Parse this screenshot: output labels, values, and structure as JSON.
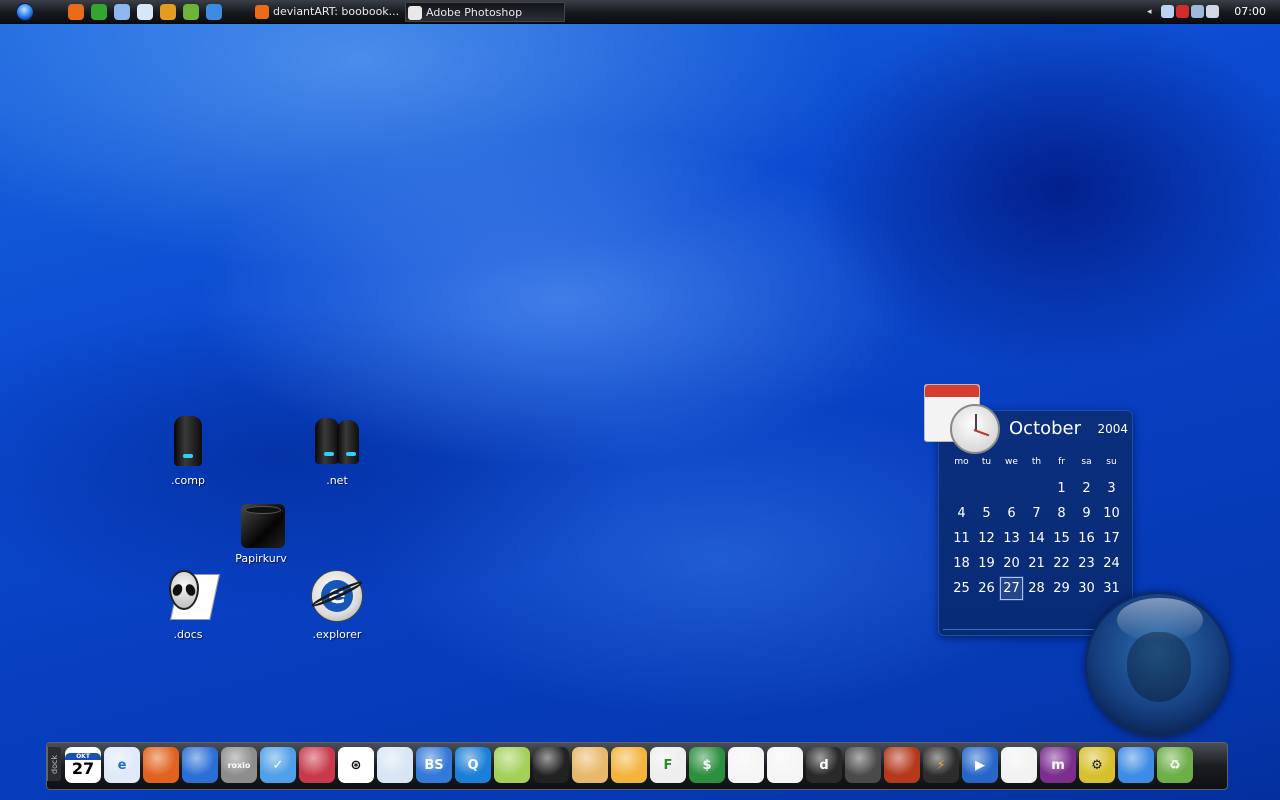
{
  "taskbar": {
    "start_icon": "windows-orb-icon",
    "quick_launch": [
      {
        "icon": "firefox-icon",
        "color": "#e86b1a"
      },
      {
        "icon": "internet-explorer-icon",
        "color": "#35a531"
      },
      {
        "icon": "show-desktop-icon",
        "color": "#8db8ef"
      },
      {
        "icon": "media-player-icon",
        "color": "#d8e6f5"
      },
      {
        "icon": "winamp-icon",
        "color": "#e39c1e"
      },
      {
        "icon": "utility-icon",
        "color": "#6fb43a"
      },
      {
        "icon": "search-icon",
        "color": "#3c8ce0"
      }
    ],
    "tasks": [
      {
        "label": "deviantART: boobook...",
        "icon": "firefox-icon",
        "active": false
      },
      {
        "label": "Adobe Photoshop",
        "icon": "photoshop-icon",
        "active": true
      }
    ],
    "tray": {
      "show_hidden": "◂",
      "icons": [
        "network-icon",
        "antivirus-icon",
        "volume-icon",
        "messenger-icon"
      ]
    },
    "clock": "07:00"
  },
  "desktop_icons": [
    {
      "label": ".comp",
      "icon": "computer-tower-icon"
    },
    {
      "label": ".net",
      "icon": "network-towers-icon"
    },
    {
      "label": "Papirkurv",
      "icon": "recycle-bin-icon"
    },
    {
      "label": ".docs",
      "icon": "alien-documents-icon"
    },
    {
      "label": ".explorer",
      "icon": "internet-explorer-icon"
    }
  ],
  "calendar": {
    "month": "October",
    "year": "2004",
    "weekdays": [
      "mo",
      "tu",
      "we",
      "th",
      "fr",
      "sa",
      "su"
    ],
    "weeks": [
      [
        "",
        "",
        "",
        "",
        "1",
        "2",
        "3"
      ],
      [
        "4",
        "5",
        "6",
        "7",
        "8",
        "9",
        "10"
      ],
      [
        "11",
        "12",
        "13",
        "14",
        "15",
        "16",
        "17"
      ],
      [
        "18",
        "19",
        "20",
        "21",
        "22",
        "23",
        "24"
      ],
      [
        "25",
        "26",
        "27",
        "28",
        "29",
        "30",
        "31"
      ]
    ],
    "today": "27"
  },
  "dock": {
    "tab_label": "dock",
    "calendar_icon": {
      "month": "OKT",
      "day": "27"
    },
    "items": [
      {
        "icon": "internet-explorer-icon",
        "bg": "#dfe9f7",
        "glyph": "e",
        "color": "#1f6fd0"
      },
      {
        "icon": "firefox-icon",
        "bg": "#e0621e",
        "glyph": "",
        "color": "#fff"
      },
      {
        "icon": "thunderbird-icon",
        "bg": "#2b6fd6",
        "glyph": "",
        "color": "#fff"
      },
      {
        "icon": "roxio-icon",
        "bg": "#8d8d8d",
        "glyph": "roxio",
        "color": "#fff"
      },
      {
        "icon": "messenger-icon",
        "bg": "#4fa0e8",
        "glyph": "✓",
        "color": "#fff"
      },
      {
        "icon": "maya-icon",
        "bg": "#c9394b",
        "glyph": "",
        "color": "#fff"
      },
      {
        "icon": "3ds-max-icon",
        "bg": "#ffffff",
        "glyph": "⊛",
        "color": "#111"
      },
      {
        "icon": "dvd-icon",
        "bg": "#d7e5f5",
        "glyph": "",
        "color": "#333"
      },
      {
        "icon": "bsplayer-icon",
        "bg": "#3379d9",
        "glyph": "BS",
        "color": "#fff"
      },
      {
        "icon": "quicktime-icon",
        "bg": "#1a7fd8",
        "glyph": "Q",
        "color": "#fff"
      },
      {
        "icon": "notepad-icon",
        "bg": "#a4d05a",
        "glyph": "",
        "color": "#fff"
      },
      {
        "icon": "horse-icon",
        "bg": "#222",
        "glyph": "",
        "color": "#fff"
      },
      {
        "icon": "paint-icon",
        "bg": "#e8b86a",
        "glyph": "",
        "color": "#fff"
      },
      {
        "icon": "reader-icon",
        "bg": "#f3b43c",
        "glyph": "",
        "color": "#fff"
      },
      {
        "icon": "ftp-icon",
        "bg": "#eee",
        "glyph": "F",
        "color": "#2a8c2a"
      },
      {
        "icon": "globe-icon",
        "bg": "#2c8e3f",
        "glyph": "$",
        "color": "#fff"
      },
      {
        "icon": "ipod-icon",
        "bg": "#f5f5f5",
        "glyph": "",
        "color": "#333"
      },
      {
        "icon": "ipod-white-icon",
        "bg": "#f5f5f5",
        "glyph": "",
        "color": "#333"
      },
      {
        "icon": "dreamweaver-icon",
        "bg": "#2a2a2a",
        "glyph": "d",
        "color": "#fff"
      },
      {
        "icon": "hard-drive-icon",
        "bg": "#4a4a4a",
        "glyph": "",
        "color": "#fff"
      },
      {
        "icon": "book-icon",
        "bg": "#b5371c",
        "glyph": "",
        "color": "#fff"
      },
      {
        "icon": "winamp-icon",
        "bg": "#2d2d2d",
        "glyph": "⚡",
        "color": "#f1a22c"
      },
      {
        "icon": "media-player-icon",
        "bg": "#2766c9",
        "glyph": "▶",
        "color": "#fff"
      },
      {
        "icon": "msn-butterfly-icon",
        "bg": "#f2f2f2",
        "glyph": "",
        "color": "#2f78d4"
      },
      {
        "icon": "mirc-icon",
        "bg": "#7b2e8e",
        "glyph": "m",
        "color": "#fff"
      },
      {
        "icon": "settings-gear-icon",
        "bg": "#d7c02d",
        "glyph": "⚙",
        "color": "#222"
      },
      {
        "icon": "network-tools-icon",
        "bg": "#3e8ce5",
        "glyph": "",
        "color": "#fff"
      },
      {
        "icon": "recycle-icon",
        "bg": "#6cae47",
        "glyph": "♻",
        "color": "#fff"
      }
    ]
  }
}
